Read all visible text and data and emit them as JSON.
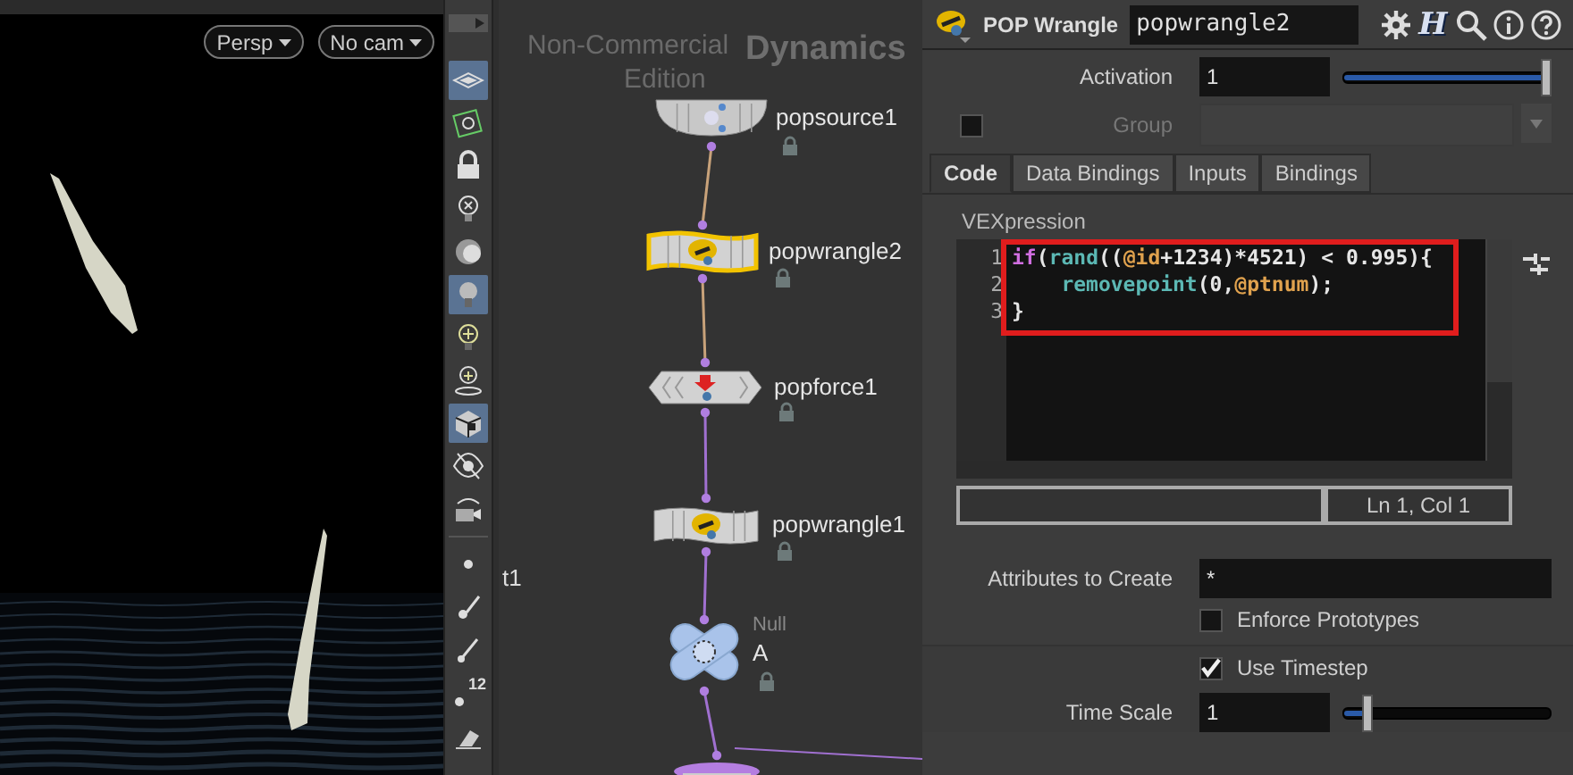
{
  "viewport": {
    "camera_menus": [
      {
        "label": "Persp"
      },
      {
        "label": "No cam"
      }
    ]
  },
  "toolbar": {
    "tools": [
      {
        "kind": "display",
        "on": true
      },
      {
        "kind": "snap",
        "on": false
      },
      {
        "kind": "lock",
        "on": false
      },
      {
        "kind": "ghost",
        "on": false
      },
      {
        "kind": "shade",
        "on": false
      },
      {
        "kind": "bulb",
        "on": true
      },
      {
        "kind": "headlight",
        "on": false
      },
      {
        "kind": "light-add",
        "on": false
      },
      {
        "kind": "render",
        "on": true
      },
      {
        "kind": "eye",
        "on": false
      },
      {
        "kind": "camera",
        "on": false
      },
      {
        "kind": "point",
        "on": false
      },
      {
        "kind": "brush",
        "on": false
      },
      {
        "kind": "pin",
        "on": false
      },
      {
        "kind": "numbers",
        "on": false,
        "label": "12"
      },
      {
        "kind": "eraser",
        "on": false
      }
    ]
  },
  "network": {
    "watermark": [
      "Non-Commercial",
      "Edition"
    ],
    "context": "Dynamics",
    "edge_label": "t1",
    "nodes": [
      {
        "kind": "source",
        "name": "popsource1",
        "selected": false
      },
      {
        "kind": "wrangle",
        "name": "popwrangle2",
        "selected": true
      },
      {
        "kind": "force",
        "name": "popforce1",
        "selected": false
      },
      {
        "kind": "wrangle",
        "name": "popwrangle1",
        "selected": false
      },
      {
        "kind": "null",
        "name": "A",
        "type_label": "Null",
        "selected": false
      },
      {
        "kind": "output",
        "selected": false
      }
    ],
    "connections": [
      {
        "color": "#c8a27a"
      },
      {
        "color": "#c8a27a"
      },
      {
        "color": "#a070d0"
      },
      {
        "color": "#a070d0"
      },
      {
        "color": "#a070d0"
      }
    ]
  },
  "parameters": {
    "header": {
      "node_type": "POP Wrangle",
      "node_name": "popwrangle2",
      "icons": [
        {
          "kind": "gear"
        },
        {
          "kind": "h-menu",
          "glyph": "H"
        },
        {
          "kind": "search"
        },
        {
          "kind": "info"
        },
        {
          "kind": "help"
        }
      ]
    },
    "activation": {
      "label": "Activation",
      "value": "1",
      "level": 1
    },
    "group": {
      "label": "Group",
      "enabled": false
    },
    "tabs": [
      {
        "label": "Code",
        "selected": true
      },
      {
        "label": "Data Bindings",
        "selected": false
      },
      {
        "label": "Inputs",
        "selected": false
      },
      {
        "label": "Bindings",
        "selected": false
      }
    ],
    "vexpression": {
      "label": "VEXpression",
      "status": "Ln 1, Col 1",
      "lines": [
        {
          "number": "1",
          "tokens": [
            {
              "text": "if",
              "kind": "keyword"
            },
            {
              "text": "(",
              "kind": "plain"
            },
            {
              "text": "rand",
              "kind": "function"
            },
            {
              "text": "((",
              "kind": "plain"
            },
            {
              "text": "@id",
              "kind": "attribute"
            },
            {
              "text": "+1234)*4521) < 0.995){",
              "kind": "plain"
            }
          ]
        },
        {
          "number": "2",
          "tokens": [
            {
              "text": "    removepoint",
              "kind": "function"
            },
            {
              "text": "(0,",
              "kind": "plain"
            },
            {
              "text": "@ptnum",
              "kind": "attribute"
            },
            {
              "text": ");",
              "kind": "plain"
            }
          ]
        },
        {
          "number": "3",
          "tokens": [
            {
              "text": "}",
              "kind": "plain"
            }
          ]
        }
      ]
    },
    "attributes_to_create": {
      "label": "Attributes to Create",
      "value": "*"
    },
    "enforce_prototypes": {
      "label": "Enforce Prototypes",
      "checked": false
    },
    "use_timestep": {
      "label": "Use Timestep",
      "checked": true
    },
    "time_scale": {
      "label": "Time Scale",
      "value": "1",
      "level": 0.1
    }
  }
}
